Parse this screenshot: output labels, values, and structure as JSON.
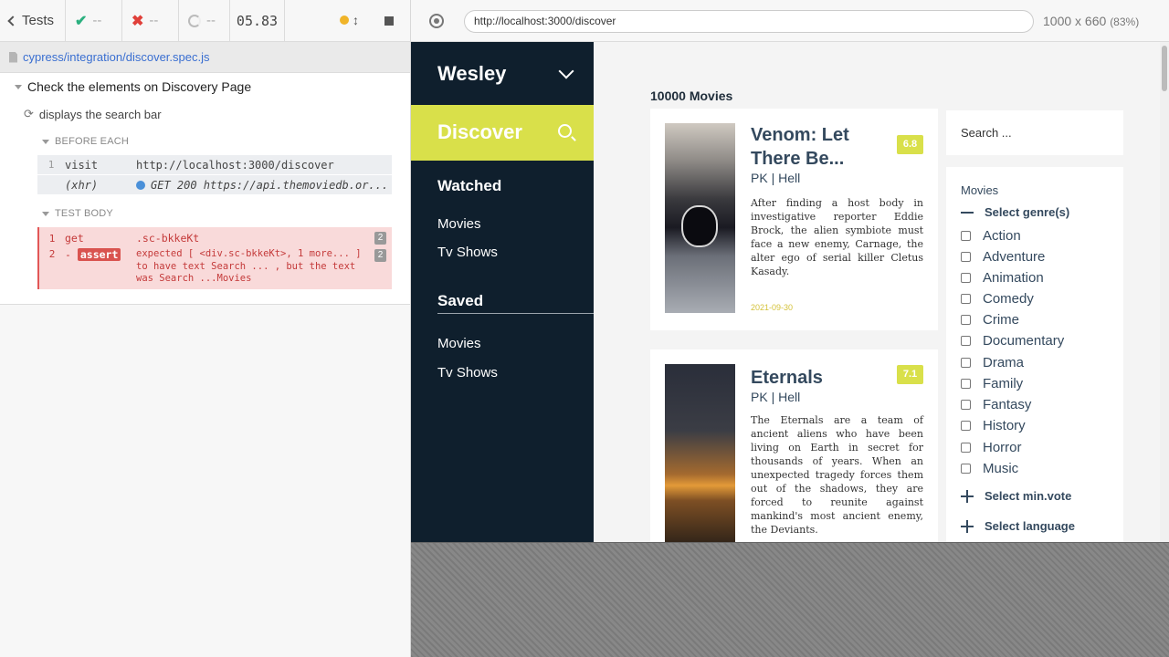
{
  "reporter": {
    "tests_label": "Tests",
    "passed": "--",
    "failed": "--",
    "pending": "--",
    "duration": "05.83"
  },
  "spec": {
    "path": "cypress/integration/discover.spec.js"
  },
  "suite": {
    "title": "Check the elements on Discovery Page",
    "test_title": "displays the search bar",
    "before_each_label": "BEFORE EACH",
    "test_body_label": "TEST BODY",
    "before_each": [
      {
        "num": "1",
        "name": "visit",
        "message": "http://localhost:3000/discover"
      },
      {
        "num": "",
        "name": "(xhr)",
        "message": "GET 200 https://api.themoviedb.or..."
      }
    ],
    "test_body": [
      {
        "num": "1",
        "name": "get",
        "message": ".sc-bkkeKt",
        "count": "2"
      },
      {
        "num": "2",
        "name": "assert",
        "message_line1": "expected [ <div.sc-bkkeKt>, 1 more... ]",
        "message_line2": "to have text Search ... , but the text",
        "message_line3": "was Search ...Movies",
        "count": "2"
      }
    ]
  },
  "browser": {
    "url": "http://localhost:3000/discover",
    "viewport": "1000 x 660",
    "zoom": "(83%)"
  },
  "app": {
    "user_name": "Wesley",
    "discover_label": "Discover",
    "watched_heading": "Watched",
    "watched_links": [
      "Movies",
      "Tv Shows"
    ],
    "saved_heading": "Saved",
    "saved_links": [
      "Movies",
      "Tv Shows"
    ],
    "movie_count": "10000 Movies",
    "search_placeholder": "Search ...",
    "movies": [
      {
        "title": "Venom: Let There Be...",
        "rating": "6.8",
        "meta": "PK | Hell",
        "description": "After finding a host body in investigative reporter Eddie Brock, the alien symbiote must face a new enemy, Carnage, the alter ego of serial killer Cletus Kasady.",
        "date": "2021-09-30"
      },
      {
        "title": "Eternals",
        "rating": "7.1",
        "meta": "PK | Hell",
        "description": "The Eternals are a team of ancient aliens who have been living on Earth in secret for thousands of years. When an unexpected tragedy forces them out of the shadows, they are forced to reunite against mankind's most ancient enemy, the Deviants."
      }
    ],
    "filters": {
      "title": "Movies",
      "genre_label": "Select genre(s)",
      "genres": [
        "Action",
        "Adventure",
        "Animation",
        "Comedy",
        "Crime",
        "Documentary",
        "Drama",
        "Family",
        "Fantasy",
        "History",
        "Horror",
        "Music"
      ],
      "min_vote_label": "Select min.vote",
      "language_label": "Select language"
    },
    "colors": {
      "sidebar_bg": "#0f1f2d",
      "accent": "#d9e04a"
    }
  }
}
